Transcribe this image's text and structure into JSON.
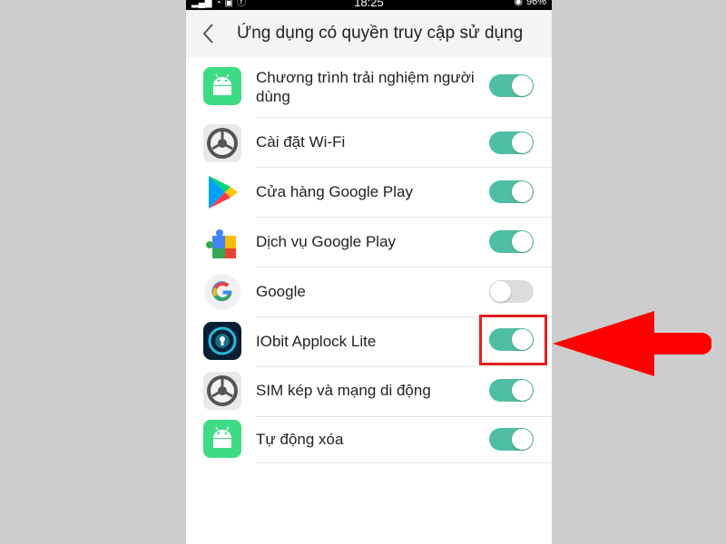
{
  "status_bar": {
    "time": "18:25",
    "battery": "96%"
  },
  "header": {
    "title": "Ứng dụng có quyền truy cập sử dụng",
    "back_icon": "chevron-left-icon"
  },
  "apps": [
    {
      "label": "Chương trình trải nghiệm người dùng",
      "icon": "android-icon",
      "enabled": true
    },
    {
      "label": "Cài đặt Wi-Fi",
      "icon": "settings-gear-icon",
      "enabled": true
    },
    {
      "label": "Cửa hàng Google Play",
      "icon": "google-play-store-icon",
      "enabled": true
    },
    {
      "label": "Dịch vụ Google Play",
      "icon": "google-play-services-icon",
      "enabled": true
    },
    {
      "label": "Google",
      "icon": "google-g-icon",
      "enabled": false
    },
    {
      "label": "IObit Applock Lite",
      "icon": "iobit-applock-icon",
      "enabled": true
    },
    {
      "label": "SIM kép và mạng di động",
      "icon": "settings-gear-icon",
      "enabled": true
    },
    {
      "label": "Tự động xóa",
      "icon": "android-icon",
      "enabled": true
    }
  ],
  "annotation": {
    "highlight_color": "#e02020",
    "target": "IObit Applock Lite"
  },
  "colors": {
    "toggle_on": "#4fbfa3",
    "toggle_off": "#dcdcdc",
    "android_green": "#3ddc84"
  }
}
